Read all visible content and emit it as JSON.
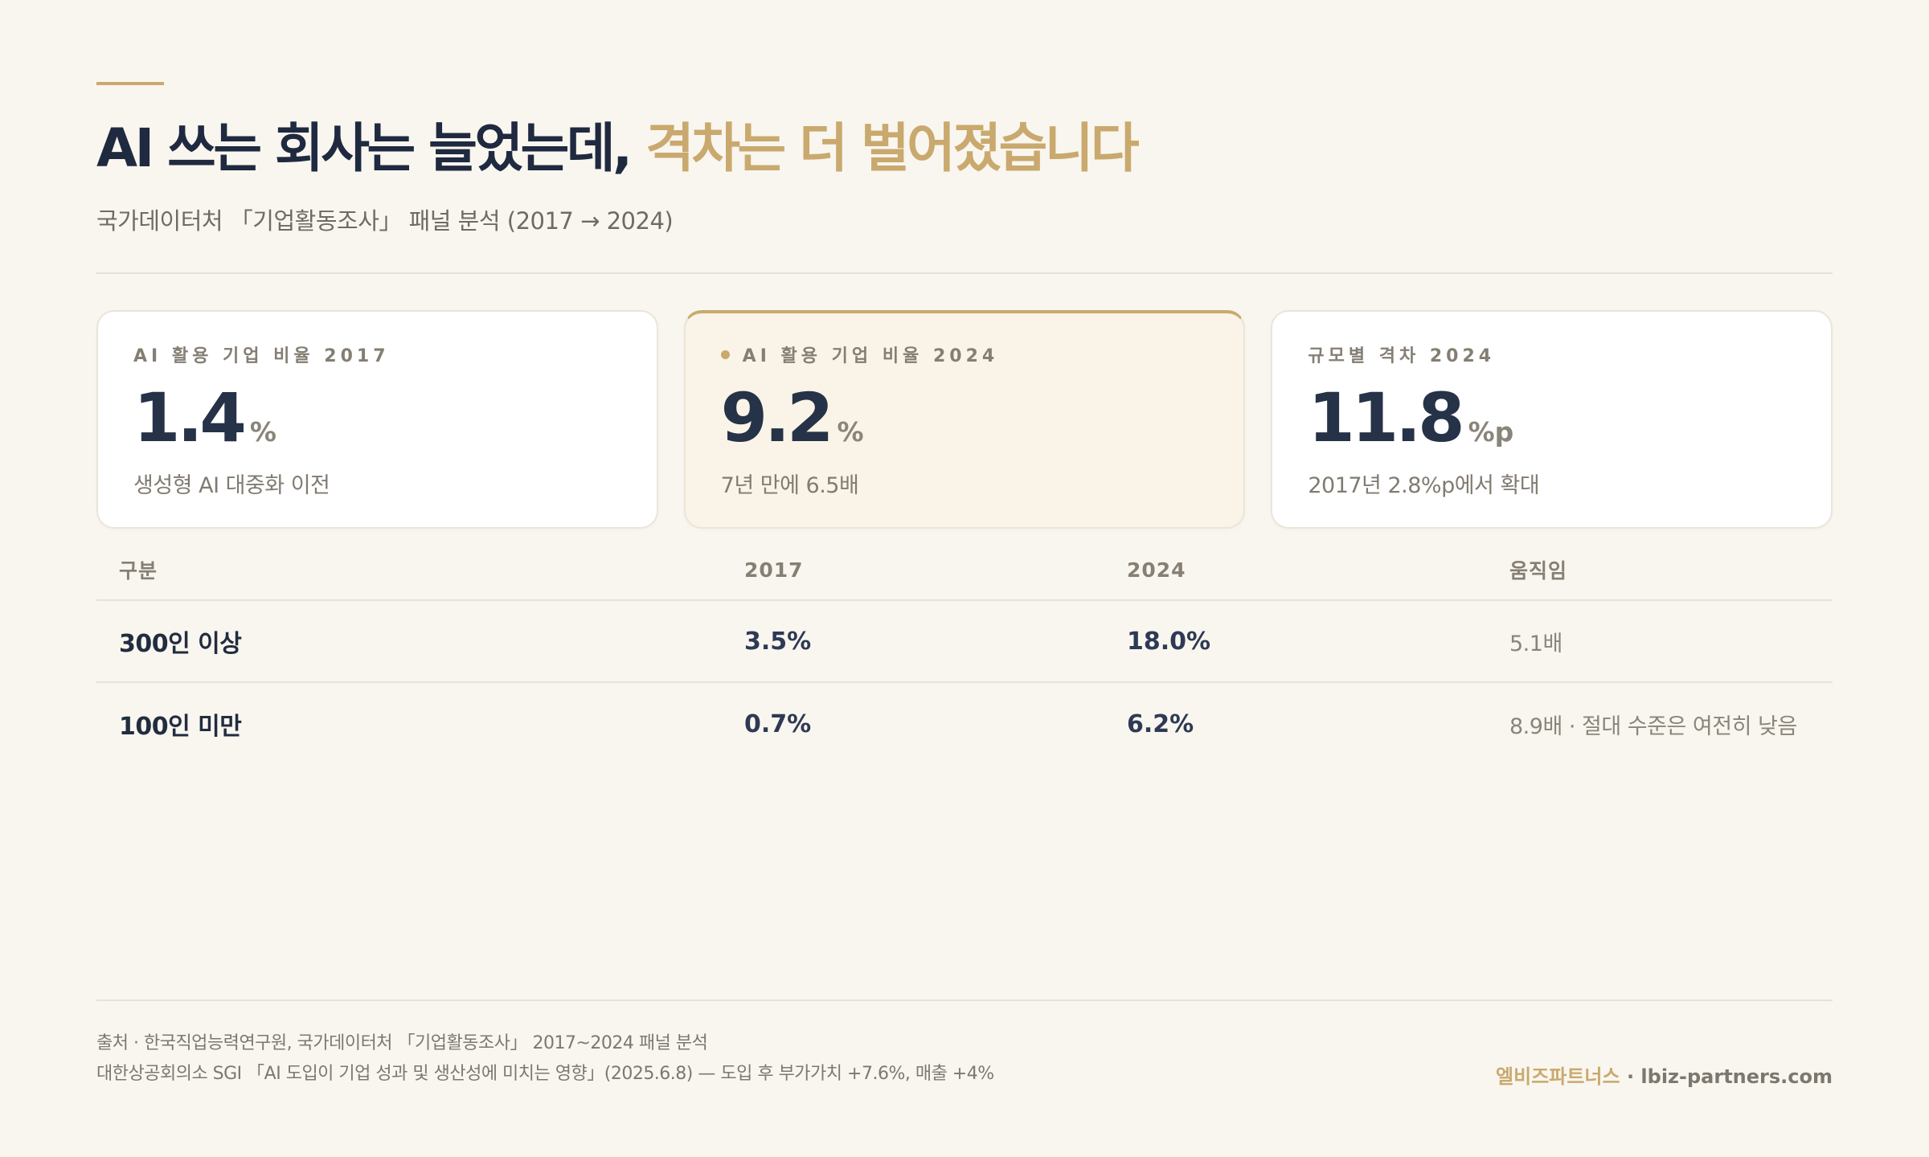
{
  "header": {
    "title_main": "AI 쓰는 회사는 늘었는데, ",
    "title_highlight": "격차는 더 벌어졌습니다",
    "subtitle": "국가데이터처 「기업활동조사」 패널 분석 (2017 → 2024)"
  },
  "cards": [
    {
      "label": "AI 활용 기업 비율 2017",
      "value": "1.4",
      "unit": "%",
      "note": "생성형 AI 대중화 이전",
      "highlight": false
    },
    {
      "label": "AI 활용 기업 비율 2024",
      "value": "9.2",
      "unit": "%",
      "note": "7년 만에 6.5배",
      "highlight": true
    },
    {
      "label": "규모별 격차 2024",
      "value": "11.8",
      "unit": "%p",
      "note": "2017년 2.8%p에서 확대",
      "highlight": false
    }
  ],
  "table": {
    "headers": [
      "구분",
      "2017",
      "2024",
      "움직임"
    ],
    "rows": [
      [
        "300인 이상",
        "3.5%",
        "18.0%",
        "5.1배"
      ],
      [
        "100인 미만",
        "0.7%",
        "6.2%",
        "8.9배 · 절대 수준은 여전히 낮음"
      ]
    ]
  },
  "footer": {
    "source_line1": "출처 · 한국직업능력연구원, 국가데이터처 「기업활동조사」 2017~2024 패널 분석",
    "source_line2": "대한상공회의소 SGI 「AI 도입이 기업 성과 및 생산성에 미치는 영향」(2025.6.8) — 도입 후 부가가치 +7.6%, 매출 +4%",
    "brand_name": "엘비즈파트너스",
    "brand_sep": " · ",
    "brand_url": "lbiz-partners.com"
  },
  "colors": {
    "background": "#f9f6ef",
    "accent": "#c9a96e",
    "navy": "#263248"
  }
}
